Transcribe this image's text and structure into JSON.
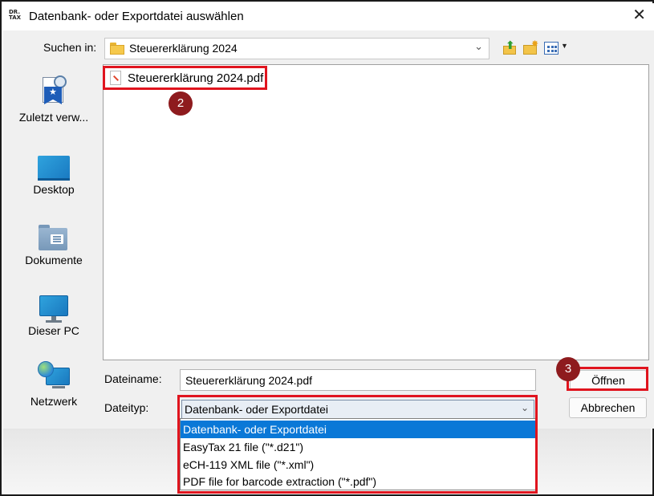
{
  "window": {
    "app_icon_lines": [
      "DR.",
      "TAX"
    ],
    "title": "Datenbank- oder Exportdatei auswählen",
    "close_glyph": "✕"
  },
  "lookin": {
    "label": "Suchen in:",
    "value": "Steuererklärung 2024",
    "chevron": "⌄"
  },
  "toolbar": {
    "up_icon": "folder-up-icon",
    "new_folder_icon": "new-folder-icon",
    "view_icon": "view-menu-icon"
  },
  "places": [
    {
      "label": "Zuletzt verw...",
      "icon": "recent-places-icon"
    },
    {
      "label": "Desktop",
      "icon": "desktop-icon"
    },
    {
      "label": "Dokumente",
      "icon": "documents-folder-icon"
    },
    {
      "label": "Dieser PC",
      "icon": "computer-icon"
    },
    {
      "label": "Netzwerk",
      "icon": "network-icon"
    }
  ],
  "files": [
    {
      "name": "Steuererklärung 2024.pdf",
      "icon": "pdf-file-icon"
    }
  ],
  "filename": {
    "label": "Dateiname:",
    "value": "Steuererklärung 2024.pdf"
  },
  "filetype": {
    "label": "Dateityp:",
    "selected": "Datenbank- oder Exportdatei",
    "options": [
      "Datenbank- oder Exportdatei",
      "EasyTax 21 file (\"*.d21\")",
      "eCH-119 XML file (\"*.xml\")",
      "PDF file for barcode extraction (\"*.pdf\")"
    ]
  },
  "buttons": {
    "open": "Öffnen",
    "cancel": "Abbrechen"
  },
  "annotations": {
    "step_2": "2",
    "step_3": "3",
    "highlight_color": "#e0141e",
    "badge_color": "#8e1b1e"
  }
}
